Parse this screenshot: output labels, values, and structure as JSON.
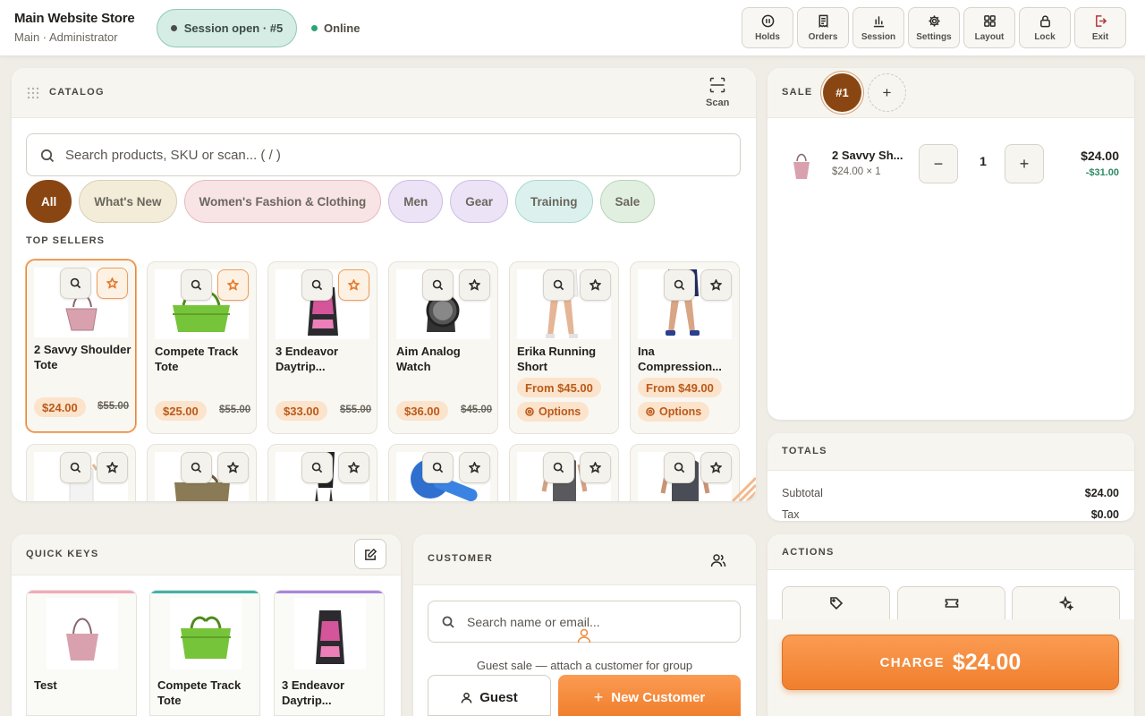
{
  "store": {
    "title": "Main Website Store",
    "subtitle": "Main · Administrator"
  },
  "session": {
    "label": "Session open · #5"
  },
  "status": {
    "label": "Online",
    "color": "#2aa576"
  },
  "toolbar": [
    {
      "label": "Holds",
      "icon": "pause-icon"
    },
    {
      "label": "Orders",
      "icon": "receipt-icon"
    },
    {
      "label": "Session",
      "icon": "bar-chart-icon"
    },
    {
      "label": "Settings",
      "icon": "gear-icon"
    },
    {
      "label": "Layout",
      "icon": "grid-icon"
    },
    {
      "label": "Lock",
      "icon": "lock-icon"
    },
    {
      "label": "Exit",
      "icon": "exit-icon"
    }
  ],
  "catalog": {
    "title": "CATALOG",
    "scan_label": "Scan",
    "search_placeholder": "Search products, SKU or scan... ( / )",
    "categories": [
      "All",
      "What's New",
      "Women's Fashion & Clothing",
      "Men",
      "Gear",
      "Training",
      "Sale"
    ],
    "section_title": "TOP SELLERS",
    "products": [
      {
        "name": "2 Savvy Shoulder Tote",
        "price": "$24.00",
        "was": "$55.00",
        "selected": true,
        "favorite": true
      },
      {
        "name": "Compete Track Tote",
        "price": "$25.00",
        "was": "$55.00",
        "favorite": true
      },
      {
        "name": "3 Endeavor Daytrip...",
        "price": "$33.00",
        "was": "$55.00",
        "favorite": true
      },
      {
        "name": "Aim Analog Watch",
        "price": "$36.00",
        "was": "$45.00"
      },
      {
        "name": "Erika Running Short",
        "price": "From $45.00",
        "options": "Options"
      },
      {
        "name": "Ina Compression...",
        "price": "From $49.00",
        "options": "Options"
      }
    ]
  },
  "sale": {
    "title": "SALE",
    "tab": "#1",
    "add_label": "+",
    "items": [
      {
        "name": "2 Savvy Sh...",
        "detail": "$24.00 × 1",
        "qty": "1",
        "minus": "−",
        "plus": "+",
        "total": "$24.00",
        "discount": "-$31.00"
      }
    ]
  },
  "totals": {
    "title": "TOTALS",
    "subtotal_label": "Subtotal",
    "subtotal": "$24.00",
    "tax_label": "Tax",
    "tax": "$0.00"
  },
  "actions": {
    "title": "ACTIONS",
    "charge_label": "CHARGE",
    "charge_amount": "$24.00"
  },
  "quick_keys": {
    "title": "QUICK KEYS",
    "items": [
      {
        "name": "Test",
        "color": "#f2aab8"
      },
      {
        "name": "Compete Track Tote",
        "color": "#3fb3a9"
      },
      {
        "name": "3 Endeavor Daytrip...",
        "color": "#a985e0"
      }
    ]
  },
  "customer": {
    "title": "CUSTOMER",
    "search_placeholder": "Search name or email...",
    "note": "Guest sale — attach a customer for group",
    "guest_label": "Guest",
    "new_label": "New Customer"
  }
}
